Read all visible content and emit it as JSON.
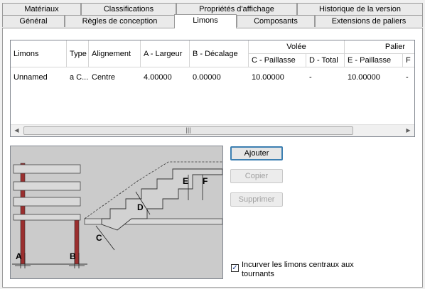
{
  "tabs_row1": [
    {
      "label": "Matériaux"
    },
    {
      "label": "Classifications"
    },
    {
      "label": "Propriétés d'affichage"
    },
    {
      "label": "Historique de la version"
    }
  ],
  "tabs_row2": [
    {
      "label": "Général"
    },
    {
      "label": "Règles de conception"
    },
    {
      "label": "Limons",
      "active": true
    },
    {
      "label": "Composants"
    },
    {
      "label": "Extensions de paliers"
    }
  ],
  "table": {
    "group_headers": {
      "volee": "Volée",
      "palier": "Palier"
    },
    "columns": [
      "Limons",
      "Type",
      "Alignement",
      "A - Largeur",
      "B - Décalage",
      "C - Paillasse",
      "D - Total",
      "E - Paillasse",
      "F"
    ],
    "rows": [
      [
        "Unnamed",
        "a C...",
        "Centre",
        "4.00000",
        "0.00000",
        "10.00000",
        "-",
        "10.00000",
        "-"
      ]
    ]
  },
  "scrollbar": {
    "left_arrow": "◀",
    "right_arrow": "▶",
    "thumb_grip": "|||"
  },
  "diagram": {
    "labels": [
      "A",
      "B",
      "C",
      "D",
      "E",
      "F"
    ]
  },
  "buttons": {
    "add": "Ajouter",
    "copy": "Copier",
    "delete": "Supprimer"
  },
  "checkbox": {
    "label": "Incurver les limons centraux aux tournants",
    "checked": true,
    "mark": "✓"
  }
}
